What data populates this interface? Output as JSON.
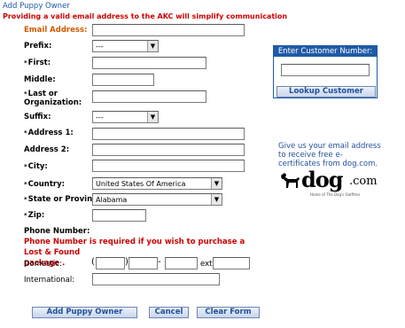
{
  "section_title": "Add Puppy Owner",
  "notice": "Providing a valid email address to the AKC will simplify communication",
  "fields": {
    "email": {
      "label": "Email Address:",
      "value": ""
    },
    "prefix": {
      "label": "Prefix:",
      "selected": "---"
    },
    "first": {
      "label": "First:",
      "value": ""
    },
    "middle": {
      "label": "Middle:",
      "value": ""
    },
    "last_line1": "Last or",
    "last_line2": "Organization:",
    "suffix": {
      "label": "Suffix:",
      "selected": "---"
    },
    "address1": {
      "label": "Address 1:",
      "value": ""
    },
    "address2": {
      "label": "Address 2:",
      "value": ""
    },
    "city": {
      "label": "City:",
      "value": ""
    },
    "country": {
      "label": "Country:",
      "selected": "United States Of America"
    },
    "state": {
      "label": "State or Province:",
      "selected": "Alabama"
    },
    "zip": {
      "label": "Zip:",
      "value": ""
    }
  },
  "required_marker": "*",
  "phone": {
    "heading": "Phone Number:",
    "note_prefix": "Phone Number is required if you wish to purchase a",
    "note_link": "Lost & Found",
    "note_suffix": "package",
    "note_period": ".",
    "domestic_label": "Domestic:",
    "open_paren": "(",
    "close_paren": ")",
    "dash": "-",
    "ext_label": "ext.",
    "international_label": "International:"
  },
  "buttons": {
    "add": "Add Puppy Owner",
    "cancel": "Cancel",
    "clear": "Clear Form"
  },
  "customer_lookup": {
    "header": "Enter Customer Number:",
    "value": "",
    "button": "Lookup Customer"
  },
  "promo": {
    "text": "Give us your email address to receive free e-certificates from dog.com.",
    "logo_text": "dog",
    "logo_suffix": ".com",
    "logo_tagline": "Home of The Dog's Outfitter"
  },
  "colors": {
    "accent_blue": "#1f5aa6",
    "required_red": "#cc0000",
    "email_label_orange": "#d05a00"
  }
}
